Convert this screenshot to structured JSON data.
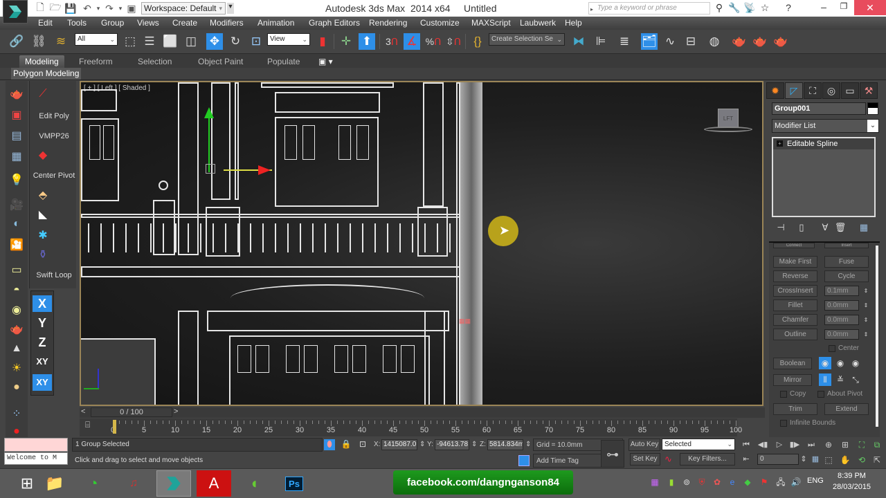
{
  "titlebar": {
    "workspace": "Workspace: Default",
    "app_title": "Autodesk 3ds Max  2014 x64",
    "doc_title": "Untitled",
    "search_placeholder": "Type a keyword or phrase"
  },
  "menubar": {
    "items": [
      "Edit",
      "Tools",
      "Group",
      "Views",
      "Create",
      "Modifiers",
      "Animation",
      "Graph Editors",
      "Rendering",
      "Customize",
      "MAXScript",
      "Laubwerk",
      "Help"
    ]
  },
  "toolbar": {
    "selection_filter": "All",
    "reference_coord": "View",
    "snap_angle_label": "3",
    "named_selection_placeholder": "Create Selection Se"
  },
  "ribbon": {
    "tabs": [
      "Modeling",
      "Freeform",
      "Selection",
      "Object Paint",
      "Populate"
    ],
    "active_tab": "Modeling",
    "panel_label": "Polygon Modeling"
  },
  "left_panel": {
    "items": [
      "Edit Poly",
      "VMPP26",
      "Center Pivot",
      "Swift Loop"
    ],
    "axis_constraints": [
      "X",
      "Y",
      "Z",
      "XY",
      "XY"
    ]
  },
  "viewport": {
    "label": "[ + ] [ Left ] [ Shaded ]",
    "viewcube_label": "LFT"
  },
  "command_panel": {
    "object_name": "Group001",
    "modifier_list": "Modifier List",
    "stack": [
      "Editable Spline"
    ],
    "buttons": {
      "connect": "Connect",
      "insert": "Insert",
      "make_first": "Make First",
      "fuse": "Fuse",
      "reverse": "Reverse",
      "cycle": "Cycle",
      "crossinsert": "CrossInsert",
      "fillet": "Fillet",
      "chamfer": "Chamfer",
      "outline": "Outline",
      "boolean": "Boolean",
      "mirror": "Mirror",
      "trim": "Trim",
      "extend": "Extend"
    },
    "spinners": {
      "crossinsert": "0.1mm",
      "fillet": "0.0mm",
      "chamfer": "0.0mm",
      "outline": "0.0mm"
    },
    "checkboxes": {
      "center": {
        "label": "Center",
        "checked": false
      },
      "copy": {
        "label": "Copy",
        "checked": false
      },
      "about_pivot": {
        "label": "About Pivot",
        "checked": false
      },
      "infinite_bounds": {
        "label": "Infinite Bounds",
        "checked": false
      }
    }
  },
  "timeline": {
    "frame_display": "0 / 100",
    "ticks": [
      0,
      5,
      10,
      15,
      20,
      25,
      30,
      35,
      40,
      45,
      50,
      55,
      60,
      65,
      70,
      75,
      80,
      85,
      90,
      95,
      100
    ],
    "current_frame": 0
  },
  "status": {
    "listener_text": "Welcome to M",
    "selection": "1 Group Selected",
    "prompt": "Click and drag to select and move objects",
    "x_label": "X:",
    "x": "1415087.0",
    "y_label": "Y:",
    "y": "-94613.78",
    "z_label": "Z:",
    "z": "5814.834m",
    "grid": "Grid = 10.0mm",
    "add_time_tag": "Add Time Tag",
    "auto_key": "Auto Key",
    "set_key": "Set Key",
    "key_mode": "Selected",
    "key_filters": "Key Filters...",
    "frame_field": "0"
  },
  "taskbar": {
    "banner": "facebook.com/dangnganson84",
    "language": "ENG",
    "time": "8:39 PM",
    "date": "28/03/2015",
    "ps_label": "Ps"
  },
  "colors": {
    "accent": "#2e8fe8",
    "viewport_border": "#9b8557",
    "close_button": "#e84c5d",
    "banner": "#138313"
  }
}
